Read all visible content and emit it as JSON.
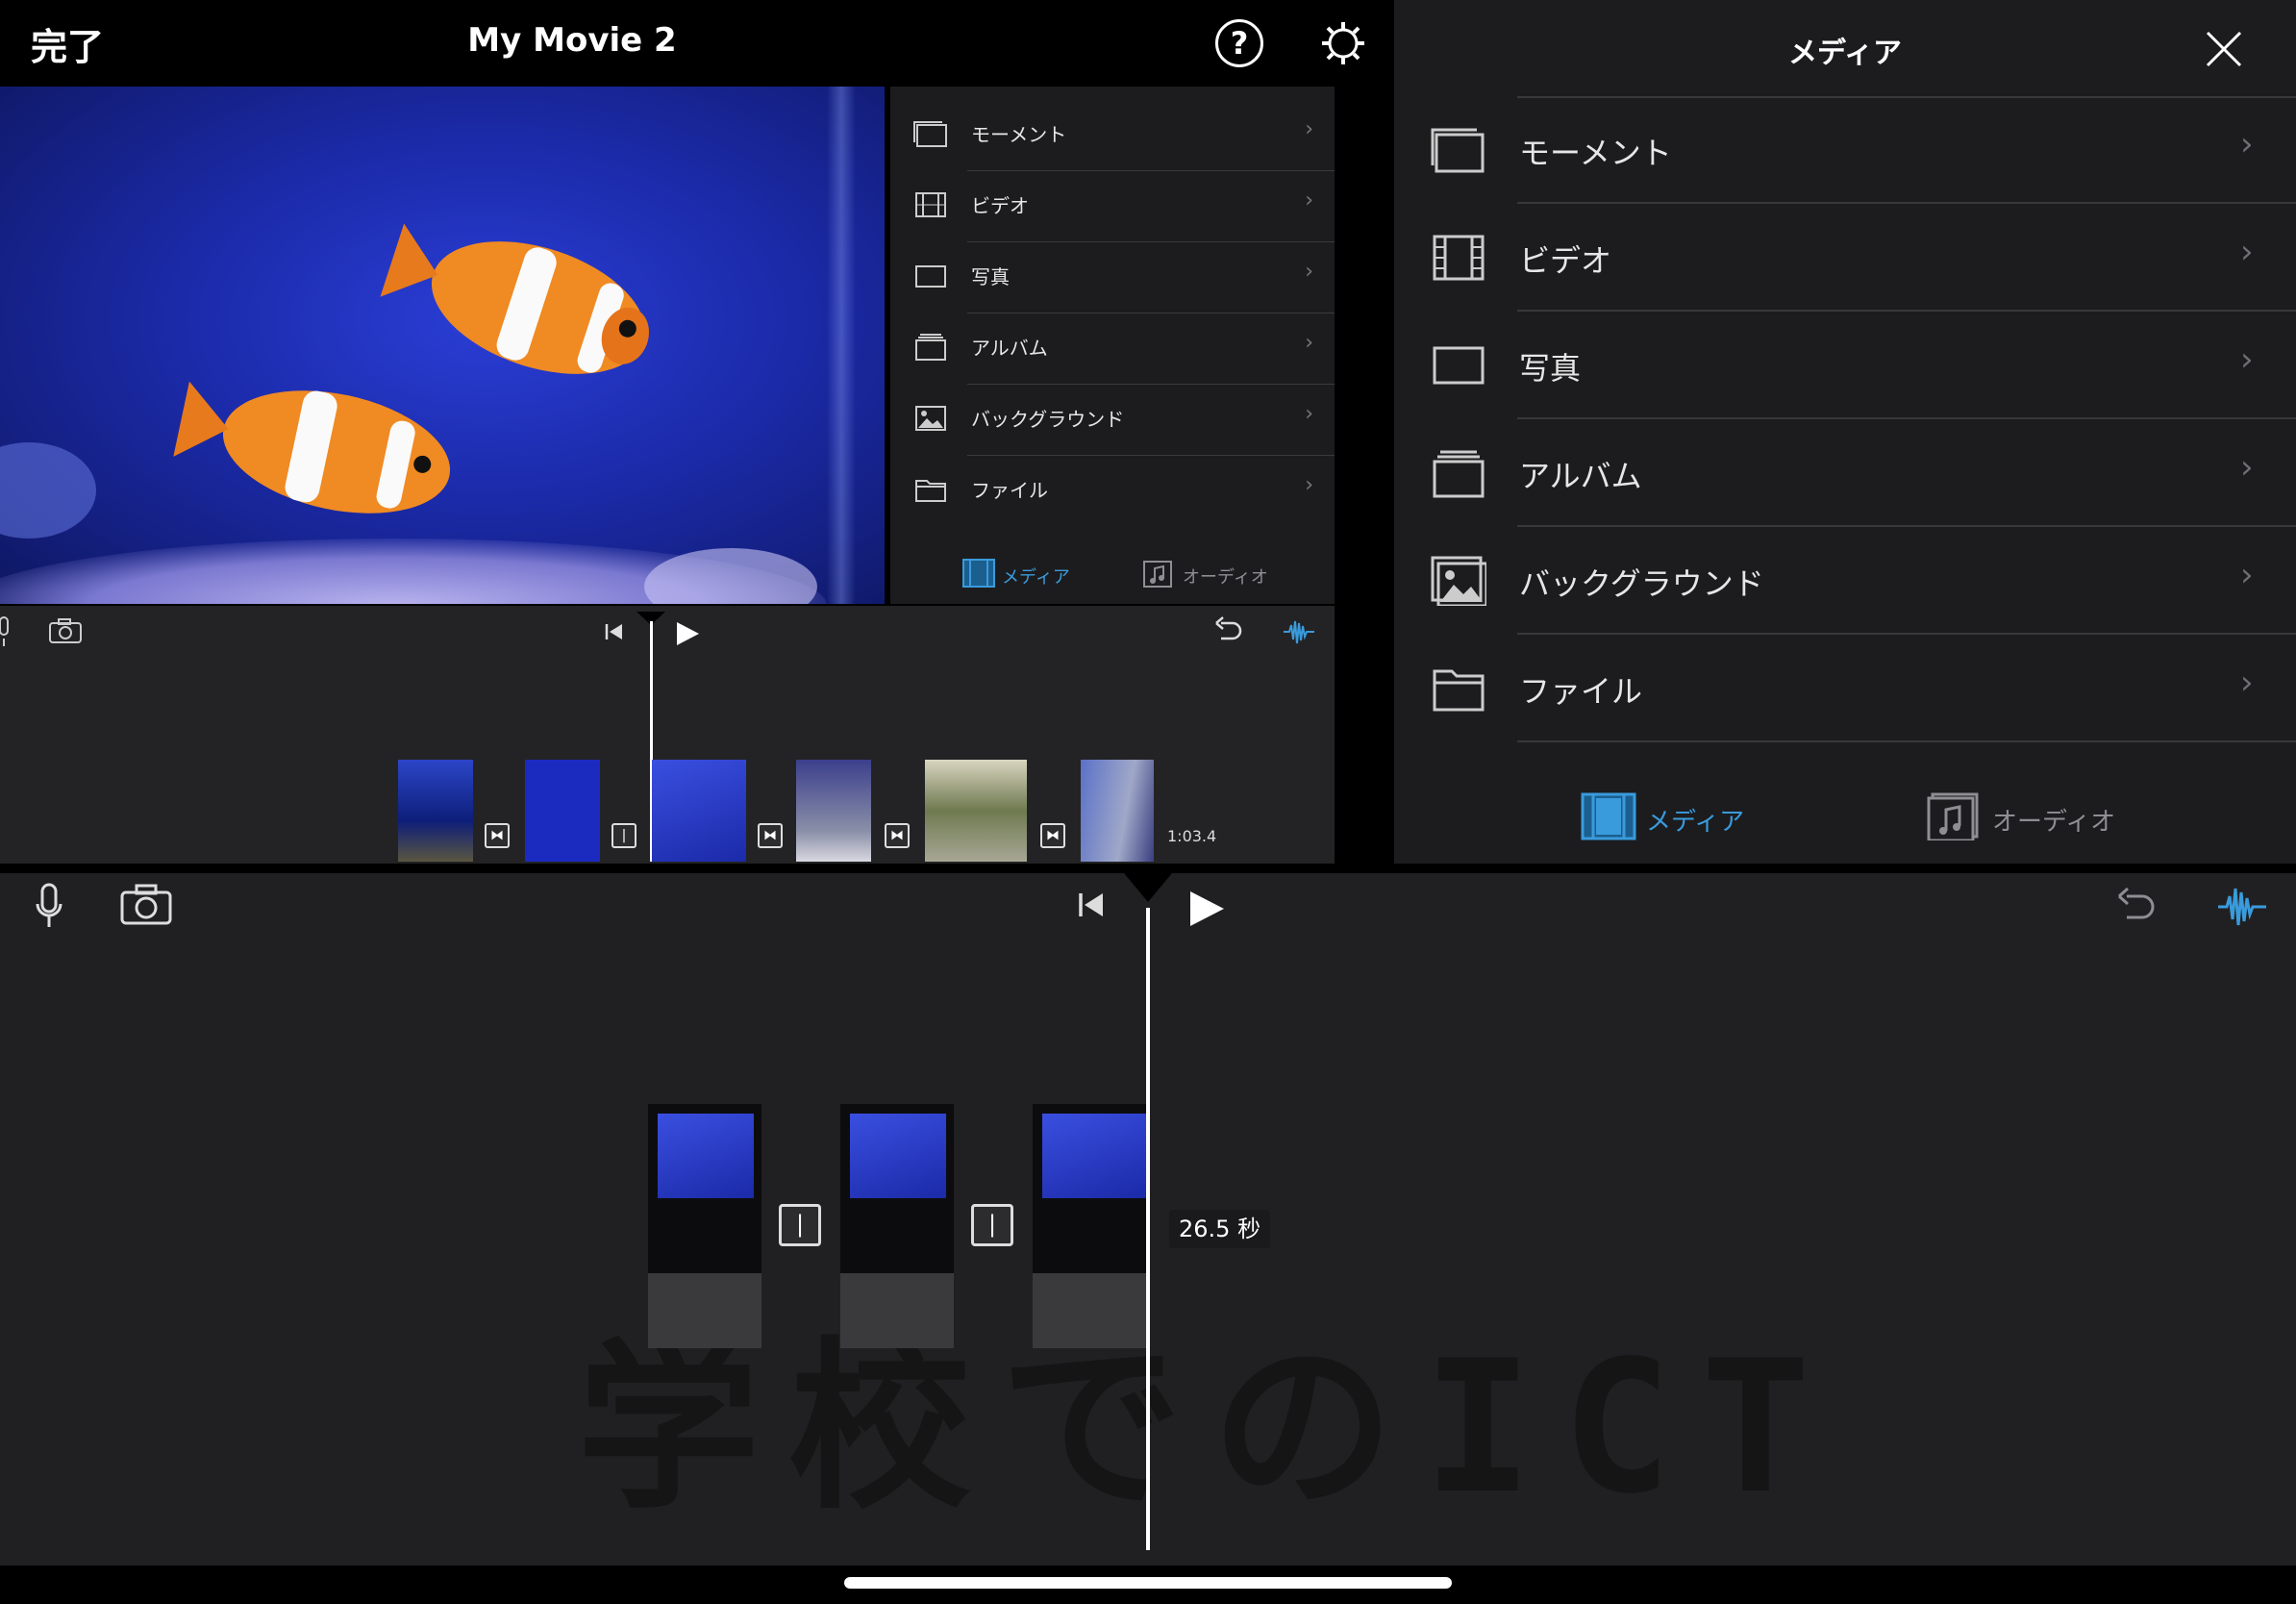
{
  "topbar": {
    "done_label": "完了",
    "title": "My Movie 2",
    "help_label": "?"
  },
  "media_list": {
    "items": [
      {
        "label": "モーメント",
        "icon": "moments-icon"
      },
      {
        "label": "ビデオ",
        "icon": "video-film-icon"
      },
      {
        "label": "写真",
        "icon": "photo-icon"
      },
      {
        "label": "アルバム",
        "icon": "album-icon"
      },
      {
        "label": "バックグラウンド",
        "icon": "background-image-icon"
      },
      {
        "label": "ファイル",
        "icon": "folder-icon"
      }
    ],
    "tabs": [
      {
        "label": "メディア",
        "active": true
      },
      {
        "label": "オーディオ",
        "active": false
      }
    ]
  },
  "large_media": {
    "title": "メディア"
  },
  "small_timeline": {
    "duration": "1:03.4"
  },
  "main_timeline": {
    "duration": "26.5 秒",
    "watermark": "学校でのICT"
  },
  "colors": {
    "accent": "#3a9bdc",
    "panel_bg": "#1c1c1e",
    "timeline_bg": "#202022"
  }
}
